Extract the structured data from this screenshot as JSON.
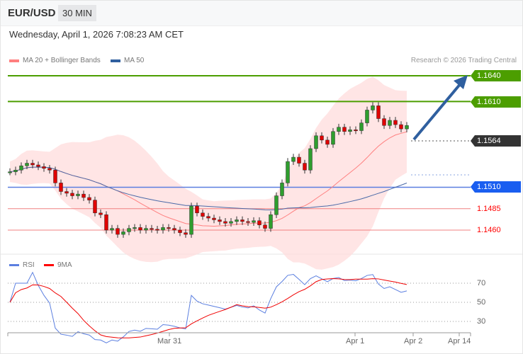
{
  "header": {
    "symbol": "EUR/USD",
    "timeframe": "30 MIN"
  },
  "timestamp": "Wednesday, April 1, 2026 7:08:23 AM CET",
  "legend": [
    {
      "label": "MA 20 + Bollinger Bands",
      "color": "#ff7f7f"
    },
    {
      "label": "MA 50",
      "color": "#2f5f9f"
    }
  ],
  "copyright": "Research © 2026 Trading Central",
  "levels": {
    "targets": [
      {
        "label": "1.1640",
        "value": 1.164,
        "color": "#4c9e00"
      },
      {
        "label": "1.1610",
        "value": 1.161,
        "color": "#4c9e00"
      }
    ],
    "current": {
      "label": "1.1564",
      "value": 1.1564,
      "color": "#333333"
    },
    "pivot": {
      "label": "1.1510",
      "value": 1.151,
      "color": "#1a5ef0"
    },
    "supports": [
      {
        "label": "1.1485",
        "value": 1.1485
      },
      {
        "label": "1.1460",
        "value": 1.146
      }
    ]
  },
  "closes": [
    1.1528,
    1.153,
    1.1535,
    1.1538,
    1.1536,
    1.1534,
    1.1532,
    1.153,
    1.1515,
    1.1505,
    1.1503,
    1.15,
    1.1502,
    1.1498,
    1.1495,
    1.148,
    1.1478,
    1.146,
    1.1462,
    1.1455,
    1.1458,
    1.1462,
    1.1463,
    1.146,
    1.1462,
    1.1461,
    1.146,
    1.1463,
    1.1462,
    1.146,
    1.1457,
    1.1455,
    1.1488,
    1.148,
    1.1476,
    1.1474,
    1.1472,
    1.147,
    1.1468,
    1.147,
    1.1472,
    1.147,
    1.1469,
    1.1471,
    1.1466,
    1.1462,
    1.1478,
    1.15,
    1.1515,
    1.154,
    1.1545,
    1.1538,
    1.153,
    1.1555,
    1.157,
    1.1565,
    1.156,
    1.1575,
    1.158,
    1.1575,
    1.1577,
    1.1576,
    1.1585,
    1.16,
    1.1605,
    1.159,
    1.1582,
    1.1588,
    1.1583,
    1.1578,
    1.1582
  ],
  "rsi": {
    "legend": [
      {
        "label": "RSI",
        "color": "#5b7fe0"
      },
      {
        "label": "9MA",
        "color": "#f00000"
      }
    ],
    "levels": [
      "70",
      "50",
      "30"
    ]
  },
  "xaxis": [
    "Mar 31",
    "Apr 1",
    "Apr 2",
    "Apr 14"
  ]
}
